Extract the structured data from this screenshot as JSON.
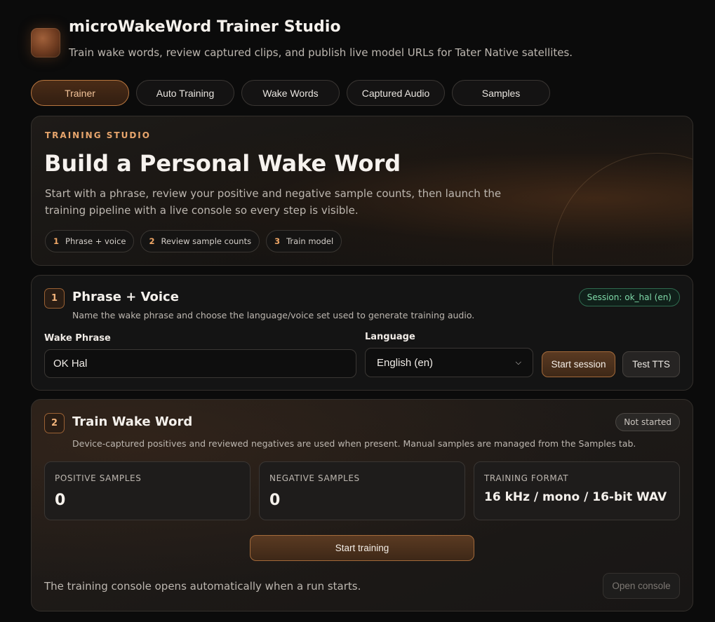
{
  "app": {
    "title": "microWakeWord Trainer Studio",
    "subtitle": "Train wake words, review captured clips, and publish live model URLs for Tater Native satellites."
  },
  "tabs": [
    {
      "label": "Trainer",
      "active": true
    },
    {
      "label": "Auto Training",
      "active": false
    },
    {
      "label": "Wake Words",
      "active": false
    },
    {
      "label": "Captured Audio",
      "active": false
    },
    {
      "label": "Samples",
      "active": false
    }
  ],
  "hero": {
    "eyebrow": "TRAINING STUDIO",
    "title": "Build a Personal Wake Word",
    "description": "Start with a phrase, review your positive and negative sample counts, then launch the training pipeline with a live console so every step is visible.",
    "steps": [
      {
        "num": "1",
        "label": "Phrase + voice"
      },
      {
        "num": "2",
        "label": "Review sample counts"
      },
      {
        "num": "3",
        "label": "Train model"
      }
    ]
  },
  "phrase_panel": {
    "step": "1",
    "title": "Phrase + Voice",
    "subtitle": "Name the wake phrase and choose the language/voice set used to generate training audio.",
    "session_badge": "Session: ok_hal (en)",
    "wake_phrase_label": "Wake Phrase",
    "wake_phrase_value": "OK Hal",
    "language_label": "Language",
    "language_value": "English (en)",
    "start_session_label": "Start session",
    "test_tts_label": "Test TTS"
  },
  "train_panel": {
    "step": "2",
    "title": "Train Wake Word",
    "subtitle": "Device-captured positives and reviewed negatives are used when present. Manual samples are managed from the Samples tab.",
    "status_badge": "Not started",
    "stats": [
      {
        "label": "POSITIVE SAMPLES",
        "value": "0"
      },
      {
        "label": "NEGATIVE SAMPLES",
        "value": "0"
      },
      {
        "label": "TRAINING FORMAT",
        "value": "16 kHz / mono / 16-bit WAV"
      }
    ],
    "start_training_label": "Start training",
    "console_note": "The training console opens automatically when a run starts.",
    "open_console_label": "Open console"
  },
  "colors": {
    "accent": "#e7a56c",
    "session_green": "#7fd8a8",
    "background": "#0b0b0b"
  }
}
